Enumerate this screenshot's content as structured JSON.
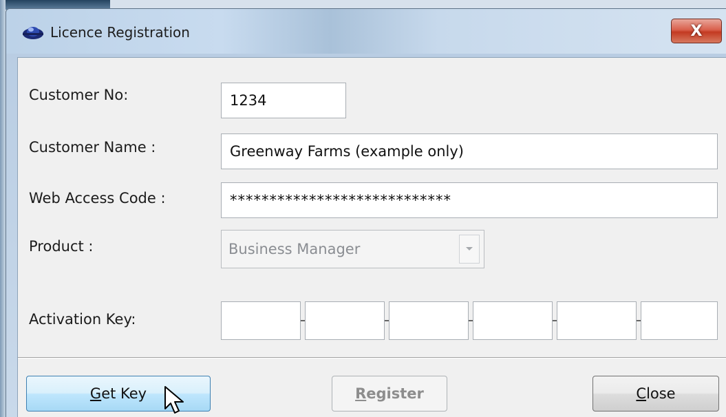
{
  "window": {
    "title": "Licence Registration",
    "close_glyph": "X"
  },
  "form": {
    "customer_no": {
      "label": "Customer No:",
      "value": "1234"
    },
    "customer_name": {
      "label": "Customer Name :",
      "value": "Greenway Farms (example only)"
    },
    "web_access_code": {
      "label": "Web Access Code :",
      "value": "****************************"
    },
    "product": {
      "label": "Product :",
      "selected": "Business Manager",
      "enabled": false
    },
    "activation_key": {
      "label": "Activation Key:",
      "segments": [
        "",
        "",
        "",
        "",
        "",
        ""
      ]
    }
  },
  "buttons": {
    "get_key": {
      "accel": "G",
      "rest": "et Key"
    },
    "register": {
      "accel": "R",
      "rest": "egister",
      "enabled": false
    },
    "close": {
      "accel": "C",
      "rest": "lose"
    }
  },
  "icons": {
    "app": "licence-app-icon",
    "close": "close-icon",
    "dropdown": "chevron-down-icon",
    "cursor": "mouse-pointer-icon"
  },
  "colors": {
    "close_button": "#c33a22",
    "hot_button": "#bee6fd",
    "client_background": "#f0f0f0"
  }
}
